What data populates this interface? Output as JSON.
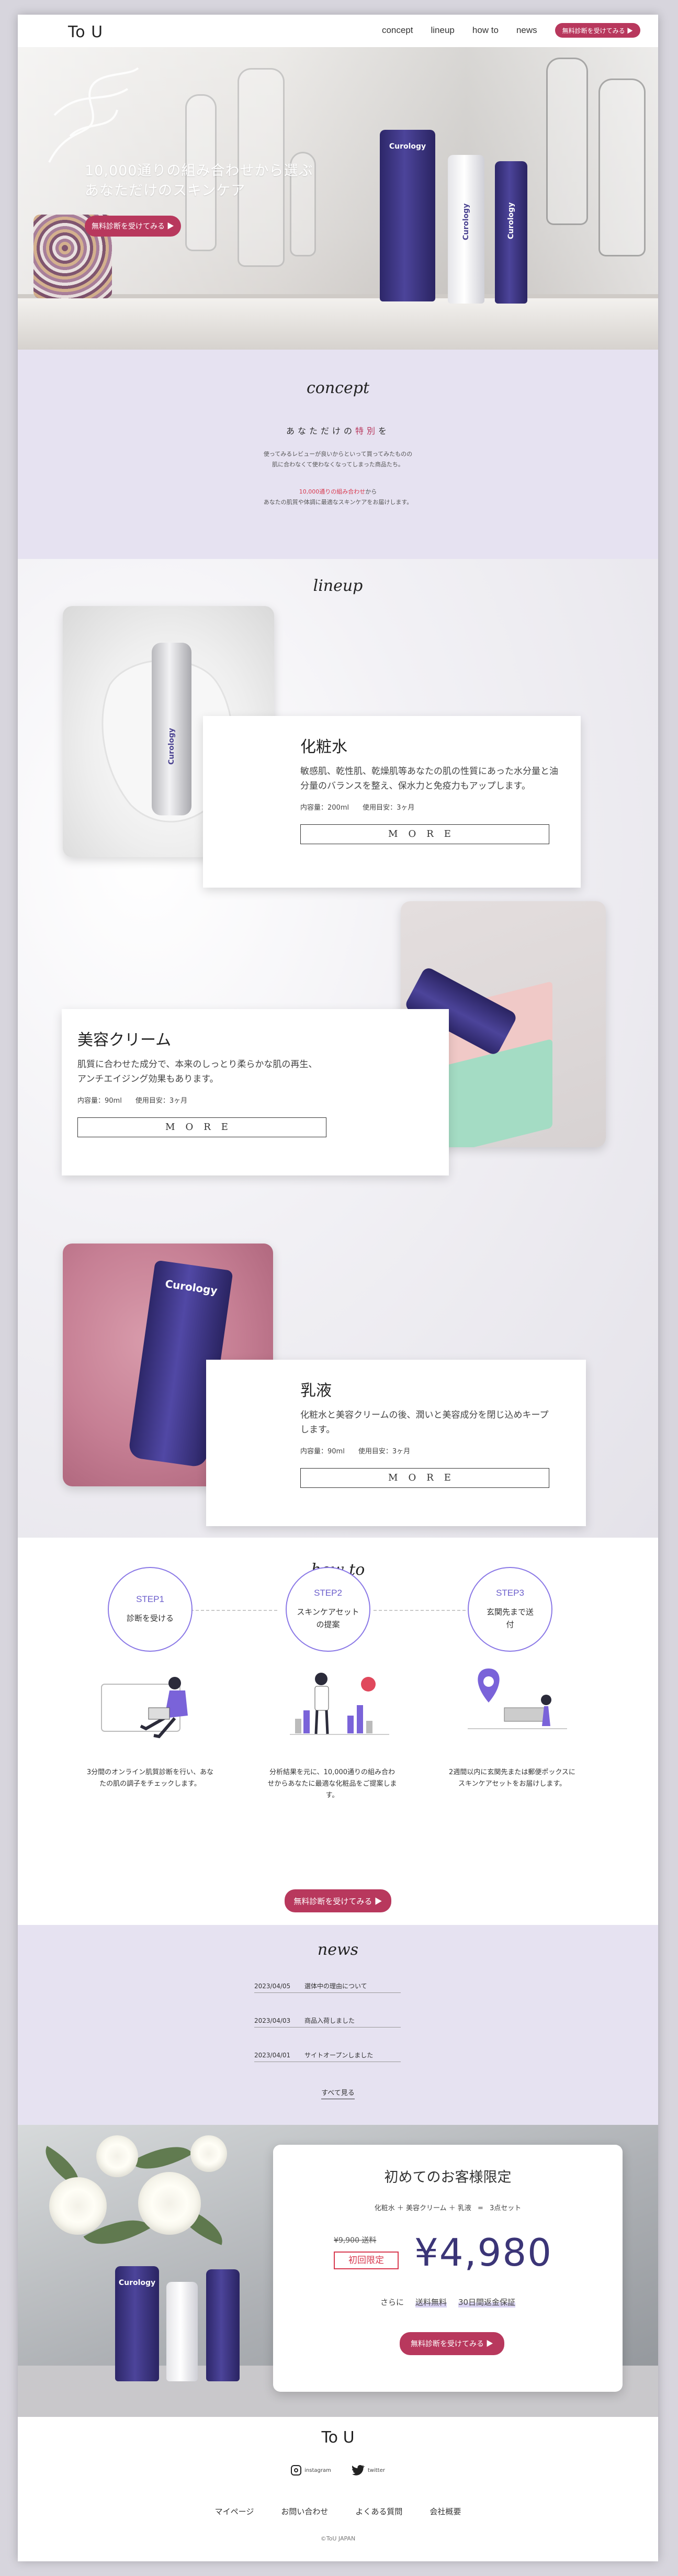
{
  "header": {
    "logo": "To U",
    "nav": [
      "concept",
      "lineup",
      "how to",
      "news"
    ],
    "cta": "無料診断を受けてみる ▶"
  },
  "hero": {
    "line1": "10,000通りの組み合わせから選ぶ",
    "line2": "あなただけのスキンケア",
    "cta": "無料診断を受けてみる ▶",
    "product_brand": "Curology"
  },
  "concept": {
    "title": "concept",
    "subtitle_pre": "あなただけの",
    "subtitle_accent": "特別",
    "subtitle_post": "を",
    "p1_line1": "使ってみるレビューが良いからといって買ってみたものの",
    "p1_line2": "肌に合わなくて使わなくなってしまった商品たち。",
    "p2_accent": "10,000通りの組み合わせ",
    "p2_post": "から",
    "p2_line2": "あなたの肌質や体調に最適なスキンケアをお届けします。"
  },
  "lineup": {
    "title": "lineup",
    "items": [
      {
        "name": "化粧水",
        "desc": "敏感肌、乾性肌、乾燥肌等あなたの肌の性質にあった水分量と油分量のバランスを整え、保水力と免疫力もアップします。",
        "spec": "内容量：200ml　　使用目安：3ヶ月",
        "more": "MORE"
      },
      {
        "name": "美容クリーム",
        "desc": "肌質に合わせた成分で、本来のしっとり柔らかな肌の再生、アンチエイジング効果もあります。",
        "spec": "内容量：90ml　　使用目安：3ヶ月",
        "more": "MORE"
      },
      {
        "name": "乳液",
        "desc": "化粧水と美容クリームの後、潤いと美容成分を閉じ込めキープします。",
        "spec": "内容量：90ml　　使用目安：3ヶ月",
        "more": "MORE"
      }
    ],
    "brand": "Curology"
  },
  "howto": {
    "title": "how to",
    "steps": [
      {
        "num": "STEP1",
        "label": "診断を受ける",
        "desc": "3分間のオンライン肌質診断を行い、あなたの肌の調子をチェックします。"
      },
      {
        "num": "STEP2",
        "label": "スキンケアセットの提案",
        "desc": "分析結果を元に、10,000通りの組み合わせからあなたに最適な化粧品をご提案します。"
      },
      {
        "num": "STEP3",
        "label": "玄関先まで送付",
        "desc": "2週間以内に玄関先または郵便ポックスにスキンケアセットをお届けします。"
      }
    ],
    "cta": "無料診断を受けてみる ▶"
  },
  "news": {
    "title": "news",
    "items": [
      {
        "date": "2023/04/05",
        "text": "選体中の理由について"
      },
      {
        "date": "2023/04/03",
        "text": "商品入荷しました"
      },
      {
        "date": "2023/04/01",
        "text": "サイトオープンしました"
      }
    ],
    "all": "すべて見る"
  },
  "promo": {
    "title": "初めてのお客様限定",
    "set_items": "化粧水 ＋ 美容クリーム ＋ 乳液",
    "set_count": "3点セット",
    "old_price": "¥9,900 送料",
    "badge": "初回限定",
    "price": "¥4,980",
    "extra_pre": "さらに",
    "extra1": "送料無料",
    "extra2": "30日間返金保証",
    "cta": "無料診断を受けてみる ▶"
  },
  "footer": {
    "logo": "To U",
    "instagram": "instagram",
    "twitter": "twitter",
    "links": [
      "マイページ",
      "お問い合わせ",
      "よくある質問",
      "会社概要"
    ],
    "copyright": "©ToU JAPAN"
  },
  "colors": {
    "accent": "#b8385d",
    "lavender": "#e6e2f1",
    "step_border": "#8a78e6",
    "product_navy": "#3b3577",
    "price": "#3b3577"
  }
}
